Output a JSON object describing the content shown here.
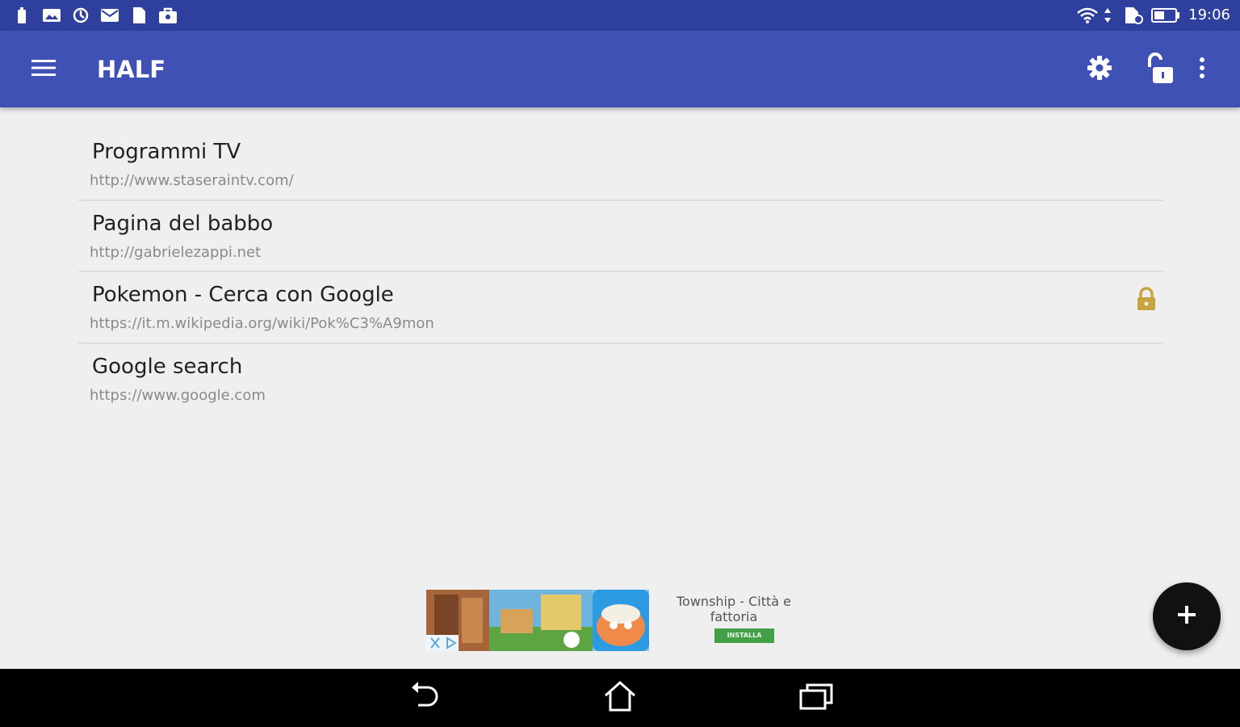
{
  "status_bar": {
    "time": "19:06",
    "left_icons": [
      "battery-saver-icon",
      "photo-icon",
      "sync-icon",
      "mail-icon",
      "file-icon",
      "shopping-bag-icon"
    ],
    "right_icons": [
      "wifi-icon",
      "data-transfer-icon",
      "sim-icon",
      "battery-icon"
    ]
  },
  "app_bar": {
    "title": "HALF",
    "color": "#3f51b5",
    "status_color": "#2f3f9e",
    "icons": [
      "menu-icon",
      "settings-icon",
      "unlock-icon",
      "more-vert-icon"
    ]
  },
  "bookmarks": [
    {
      "title": "Programmi TV",
      "url": "http://www.staseraintv.com/",
      "locked": false
    },
    {
      "title": "Pagina del babbo",
      "url": "http://gabrielezappi.net",
      "locked": false
    },
    {
      "title": "Pokemon - Cerca con Google",
      "url": "https://it.m.wikipedia.org/wiki/Pok%C3%A9mon",
      "locked": true
    },
    {
      "title": "Google search",
      "url": "https://www.google.com",
      "locked": false
    }
  ],
  "ad": {
    "title": "Township - Città e fattoria",
    "install_label": "INSTALLA",
    "install_color": "#43a047"
  },
  "fab": {
    "icon": "plus-icon"
  },
  "nav_bar": {
    "icons": [
      "back-icon",
      "home-icon",
      "recents-icon"
    ]
  }
}
